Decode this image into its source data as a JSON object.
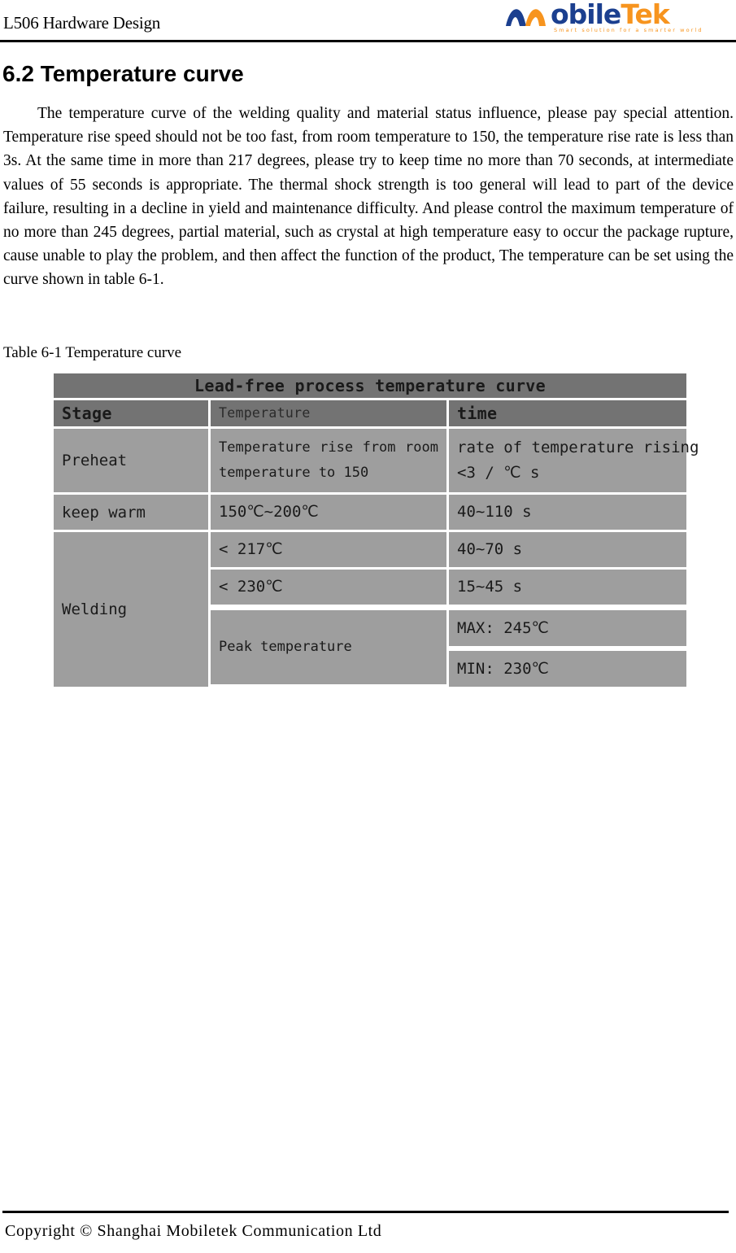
{
  "header": {
    "document_title": "L506 Hardware Design",
    "logo": {
      "name_part_1": "obile",
      "name_part_2": "Tek",
      "tagline": "Smart solution for a smarter world",
      "mark_color_blue": "#1b3f8f",
      "mark_color_orange": "#f7941e"
    }
  },
  "section": {
    "heading": "6.2 Temperature curve",
    "paragraph": "The temperature curve of the welding quality and material status influence, please pay special attention. Temperature rise speed should not be too fast, from room temperature to 150, the temperature rise rate is less than 3s. At the same time in more than 217 degrees, please try to keep time no more than 70 seconds, at intermediate values of 55 seconds is appropriate. The thermal shock strength is too general will lead to part of the device failure, resulting in a decline in yield and maintenance difficulty. And please control the maximum temperature of no more than 245 degrees, partial material, such as crystal at high temperature easy to occur the package rupture, cause unable to play the problem, and then affect the function of the product, The temperature can be set using the curve shown in table 6-1."
  },
  "table": {
    "caption": "Table 6-1 Temperature curve",
    "title": "Lead-free process temperature curve",
    "columns": [
      "Stage",
      "Temperature",
      "time"
    ],
    "colors": {
      "header_background": "#737373",
      "cell_background": "#9e9e9e",
      "gap": "#ffffff"
    },
    "rows": [
      {
        "stage": "Preheat",
        "temperature_line_1": "Temperature rise from room",
        "temperature_line_2": "temperature to 150",
        "time_line_1": "rate of temperature rising",
        "time_line_2": "<3 / ℃ s"
      },
      {
        "stage": "keep warm",
        "temperature": "150℃~200℃",
        "time": "40~110 s"
      },
      {
        "stage": "Welding",
        "sub_rows": [
          {
            "temperature": "< 217℃",
            "time": "40~70 s"
          },
          {
            "temperature": "< 230℃",
            "time": "15~45 s"
          },
          {
            "temperature": "Peak temperature",
            "time": "MAX: 245℃"
          },
          {
            "temperature": "",
            "time": "MIN: 230℃"
          }
        ]
      }
    ]
  },
  "footer": {
    "copyright": "Copyright © Shanghai Mobiletek Communication Ltd"
  }
}
